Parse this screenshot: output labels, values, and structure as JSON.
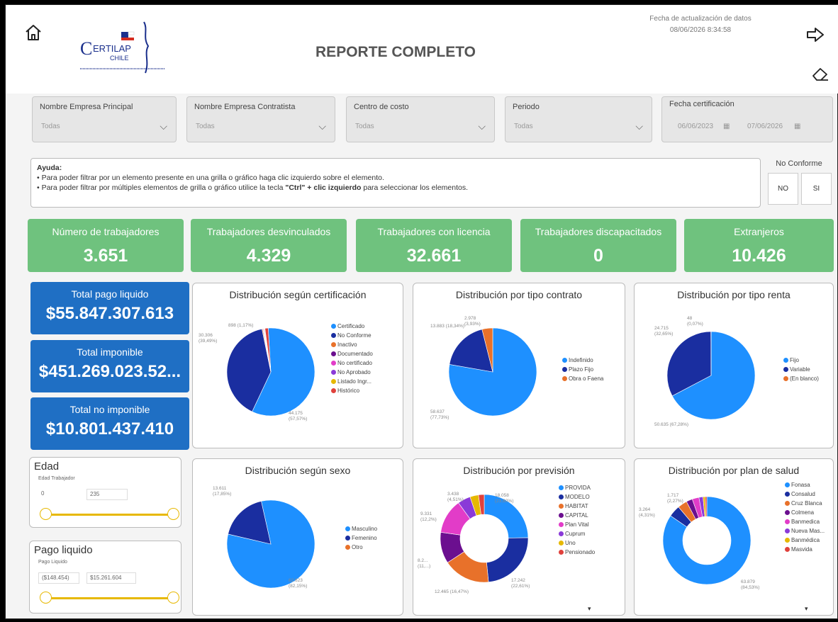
{
  "header": {
    "title": "REPORTE COMPLETO",
    "fecha_label": "Fecha de actualización de datos",
    "fecha_value": "08/06/2026 8:34:58",
    "logo_text": "CERTILAP",
    "logo_sub": "CHILE"
  },
  "filters": [
    {
      "label": "Nombre Empresa Principal",
      "value": "Todas"
    },
    {
      "label": "Nombre Empresa Contratista",
      "value": "Todas"
    },
    {
      "label": "Centro de costo",
      "value": "Todas"
    },
    {
      "label": "Periodo",
      "value": "Todas"
    },
    {
      "label": "Fecha certificación",
      "from": "06/06/2023",
      "to": "07/06/2026"
    }
  ],
  "help": {
    "title": "Ayuda:",
    "line1": "• Para poder filtrar por un elemento presente en una grilla o gráfico haga clic izquierdo sobre el elemento.",
    "line2_a": "• Para poder filtrar por múltiples elementos de grilla o gráfico utilice la tecla ",
    "line2_b": "\"Ctrl\" + clic izquierdo",
    "line2_c": " para seleccionar los elementos."
  },
  "no_conforme": {
    "title": "No Conforme",
    "no": "NO",
    "si": "SI"
  },
  "kpis": [
    {
      "title": "Número de trabajadores",
      "value": "3.651"
    },
    {
      "title": "Trabajadores desvinculados",
      "value": "4.329"
    },
    {
      "title": "Trabajadores con licencia",
      "value": "32.661"
    },
    {
      "title": "Trabajadores discapacitados",
      "value": "0"
    },
    {
      "title": "Extranjeros",
      "value": "10.426"
    }
  ],
  "totals": [
    {
      "title": "Total pago liquido",
      "value": "$55.847.307.613"
    },
    {
      "title": "Total imponible",
      "value": "$451.269.023.52..."
    },
    {
      "title": "Total no imponible",
      "value": "$10.801.437.410"
    }
  ],
  "slicers": {
    "edad": {
      "title": "Edad",
      "sub": "Edad Trabajador",
      "min": "0",
      "max": "235",
      "range": [
        0,
        1
      ]
    },
    "pago": {
      "title": "Pago liquido",
      "sub": "Pago Liquido",
      "min": "($148.454)",
      "max": "$15.261.604",
      "range": [
        0,
        1
      ]
    }
  },
  "colors": {
    "light_blue": "#1e90ff",
    "dark_blue": "#1a2ea0",
    "orange": "#e8712a",
    "purple": "#6b0f8f",
    "magenta": "#e23cc8",
    "violet": "#8a3ad8",
    "yellow": "#e6b800",
    "red": "#e0413c",
    "kpi_green": "#6fc27e",
    "card_blue": "#1f6fc4"
  },
  "chart_data": [
    {
      "type": "pie",
      "title": "Distribución según certificación",
      "categories": [
        "Certificado",
        "No Conforme",
        "Inactivo",
        "Documentado",
        "No certificado",
        "No Aprobado",
        "Listado Ingr...",
        "Histórico"
      ],
      "values": [
        57.57,
        39.49,
        0.3,
        0.2,
        0.2,
        0.2,
        0.2,
        1.17
      ],
      "labels": [
        [
          "44.175",
          "(57,57%)"
        ],
        [
          "30.306",
          "(39,49%)"
        ],
        [
          "898 (1,17%)"
        ]
      ]
    },
    {
      "type": "pie",
      "title": "Distribución por tipo contrato",
      "categories": [
        "Indefinido",
        "Plazo Fijo",
        "Obra o Faena"
      ],
      "values": [
        77.73,
        18.34,
        3.93
      ],
      "labels": [
        [
          "58.637",
          "(77,73%)"
        ],
        [
          "13.883 (18,34%)"
        ],
        [
          "2.978",
          "(3,93%)"
        ]
      ]
    },
    {
      "type": "pie",
      "title": "Distribución por tipo renta",
      "categories": [
        "Fijo",
        "Variable",
        "(En blanco)"
      ],
      "values": [
        67.28,
        32.65,
        0.07
      ],
      "labels": [
        [
          "50.635 (67,28%)"
        ],
        [
          "24.715",
          "(32,65%)"
        ],
        [
          "48",
          "(0,07%)"
        ]
      ]
    },
    {
      "type": "pie",
      "title": "Distribución según sexo",
      "categories": [
        "Masculino",
        "Femenino",
        "Otro"
      ],
      "values": [
        82.15,
        17.85,
        0.0
      ],
      "labels": [
        [
          "62.623",
          "(82,15%)"
        ],
        [
          "13.611",
          "(17,85%)"
        ]
      ]
    },
    {
      "type": "pie",
      "title": "Distribución por previsión",
      "categories": [
        "PROVIDA",
        "MODELO",
        "HABITAT",
        "CAPITAL",
        "Plan Vital",
        "Cuprum",
        "Uno",
        "Pensionado"
      ],
      "values": [
        23.6,
        22.61,
        16.47,
        11.0,
        12.2,
        4.51,
        3.0,
        2.0
      ],
      "labels": [
        [
          "18.058",
          "(23,60%)"
        ],
        [
          "17.242",
          "(22,61%)"
        ],
        [
          "12.465 (16,47%)"
        ],
        [
          "8.2...",
          "(11,...)"
        ],
        [
          "9.331",
          "(12,2%)"
        ],
        [
          "3.438",
          "(4,51%)"
        ]
      ]
    },
    {
      "type": "pie",
      "title": "Distribución por plan de salud",
      "categories": [
        "Fonasa",
        "Consalud",
        "Cruz Blanca",
        "Colmena",
        "Banmedica",
        "Nueva Mas...",
        "Banmédica",
        "Masvida"
      ],
      "values": [
        84.53,
        4.31,
        3.5,
        2.27,
        2.5,
        1.5,
        0.8,
        0.59
      ],
      "labels": [
        [
          "63.879",
          "(84,53%)"
        ],
        [
          "3.264",
          "(4,31%)"
        ],
        [
          "1.717",
          "(2,27%)"
        ]
      ]
    }
  ]
}
